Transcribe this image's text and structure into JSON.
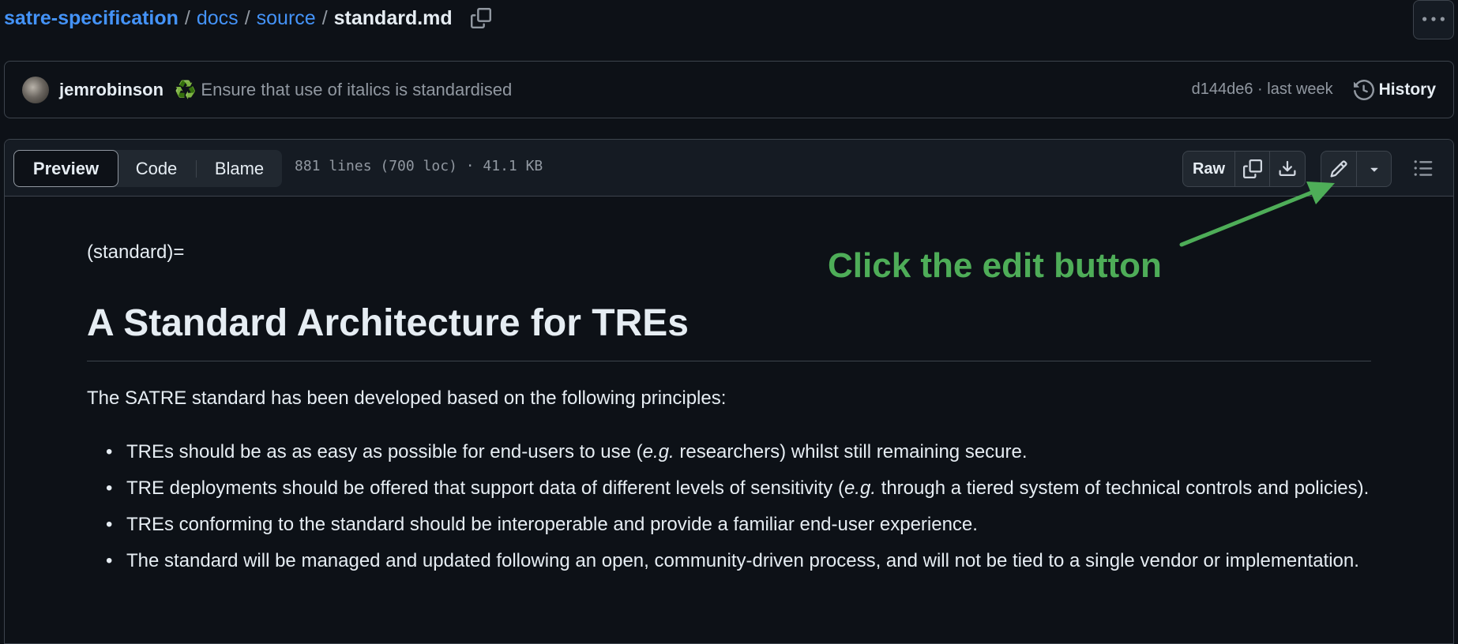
{
  "breadcrumb": {
    "repo": "satre-specification",
    "dir1": "docs",
    "dir2": "source",
    "file": "standard.md",
    "separator": "/"
  },
  "commit": {
    "author": "jemrobinson",
    "emoji": "♻️",
    "message": "Ensure that use of italics is standardised",
    "meta": "d144de6 · last week",
    "history_label": "History"
  },
  "file_header": {
    "tabs": [
      "Preview",
      "Code",
      "Blame"
    ],
    "active_tab": "Preview",
    "stats": "881 lines (700 loc) · 41.1 KB",
    "raw_label": "Raw"
  },
  "markdown": {
    "label_line": "(standard)=",
    "heading": "A Standard Architecture for TREs",
    "intro": "The SATRE standard has been developed based on the following principles:",
    "items": [
      {
        "pre": "TREs should be as as easy as possible for end-users to use (",
        "em": "e.g.",
        "post": " researchers) whilst still remaining secure."
      },
      {
        "pre": "TRE deployments should be offered that support data of different levels of sensitivity (",
        "em": "e.g.",
        "post": " through a tiered system of technical controls and policies)."
      },
      {
        "pre": "TREs conforming to the standard should be interoperable and provide a familiar end-user experience.",
        "em": "",
        "post": ""
      },
      {
        "pre": "The standard will be managed and updated following an open, community-driven process, and will not be tied to a single vendor or implementation.",
        "em": "",
        "post": ""
      }
    ]
  },
  "annotation": {
    "label": "Click the edit button",
    "color": "#4ead58"
  },
  "icons": {
    "copy": "copy-icon",
    "more": "kebab-horizontal-icon",
    "history": "history-icon",
    "copy_raw": "copy-icon",
    "download": "download-icon",
    "edit": "pencil-icon",
    "dropdown": "triangle-down-icon",
    "symbols": "list-unordered-icon"
  }
}
